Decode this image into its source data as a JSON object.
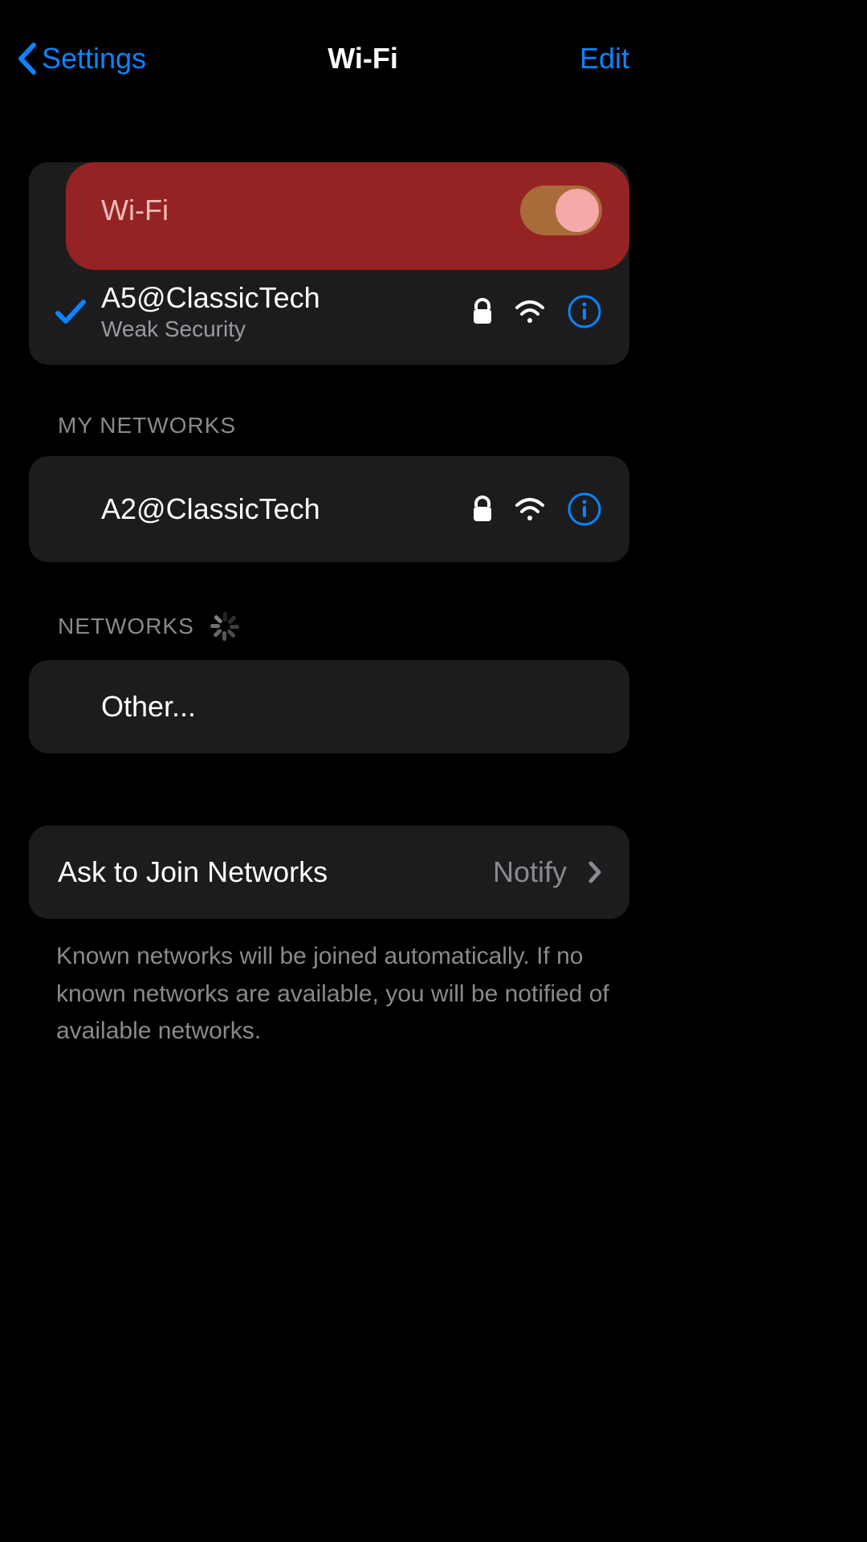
{
  "nav": {
    "back": "Settings",
    "title": "Wi-Fi",
    "edit": "Edit"
  },
  "wifi_switch": {
    "label": "Wi-Fi",
    "on": true
  },
  "connected": {
    "name": "A5@ClassicTech",
    "sub": "Weak Security",
    "secured": true
  },
  "sections": {
    "my_networks_header": "MY NETWORKS",
    "my_networks": [
      {
        "name": "A2@ClassicTech",
        "secured": true
      }
    ],
    "networks_header": "NETWORKS",
    "networks": {
      "other_label": "Other..."
    }
  },
  "ask": {
    "label": "Ask to Join Networks",
    "value": "Notify"
  },
  "footer": "Known networks will be joined automatically. If no known networks are available, you will be notified of available networks."
}
